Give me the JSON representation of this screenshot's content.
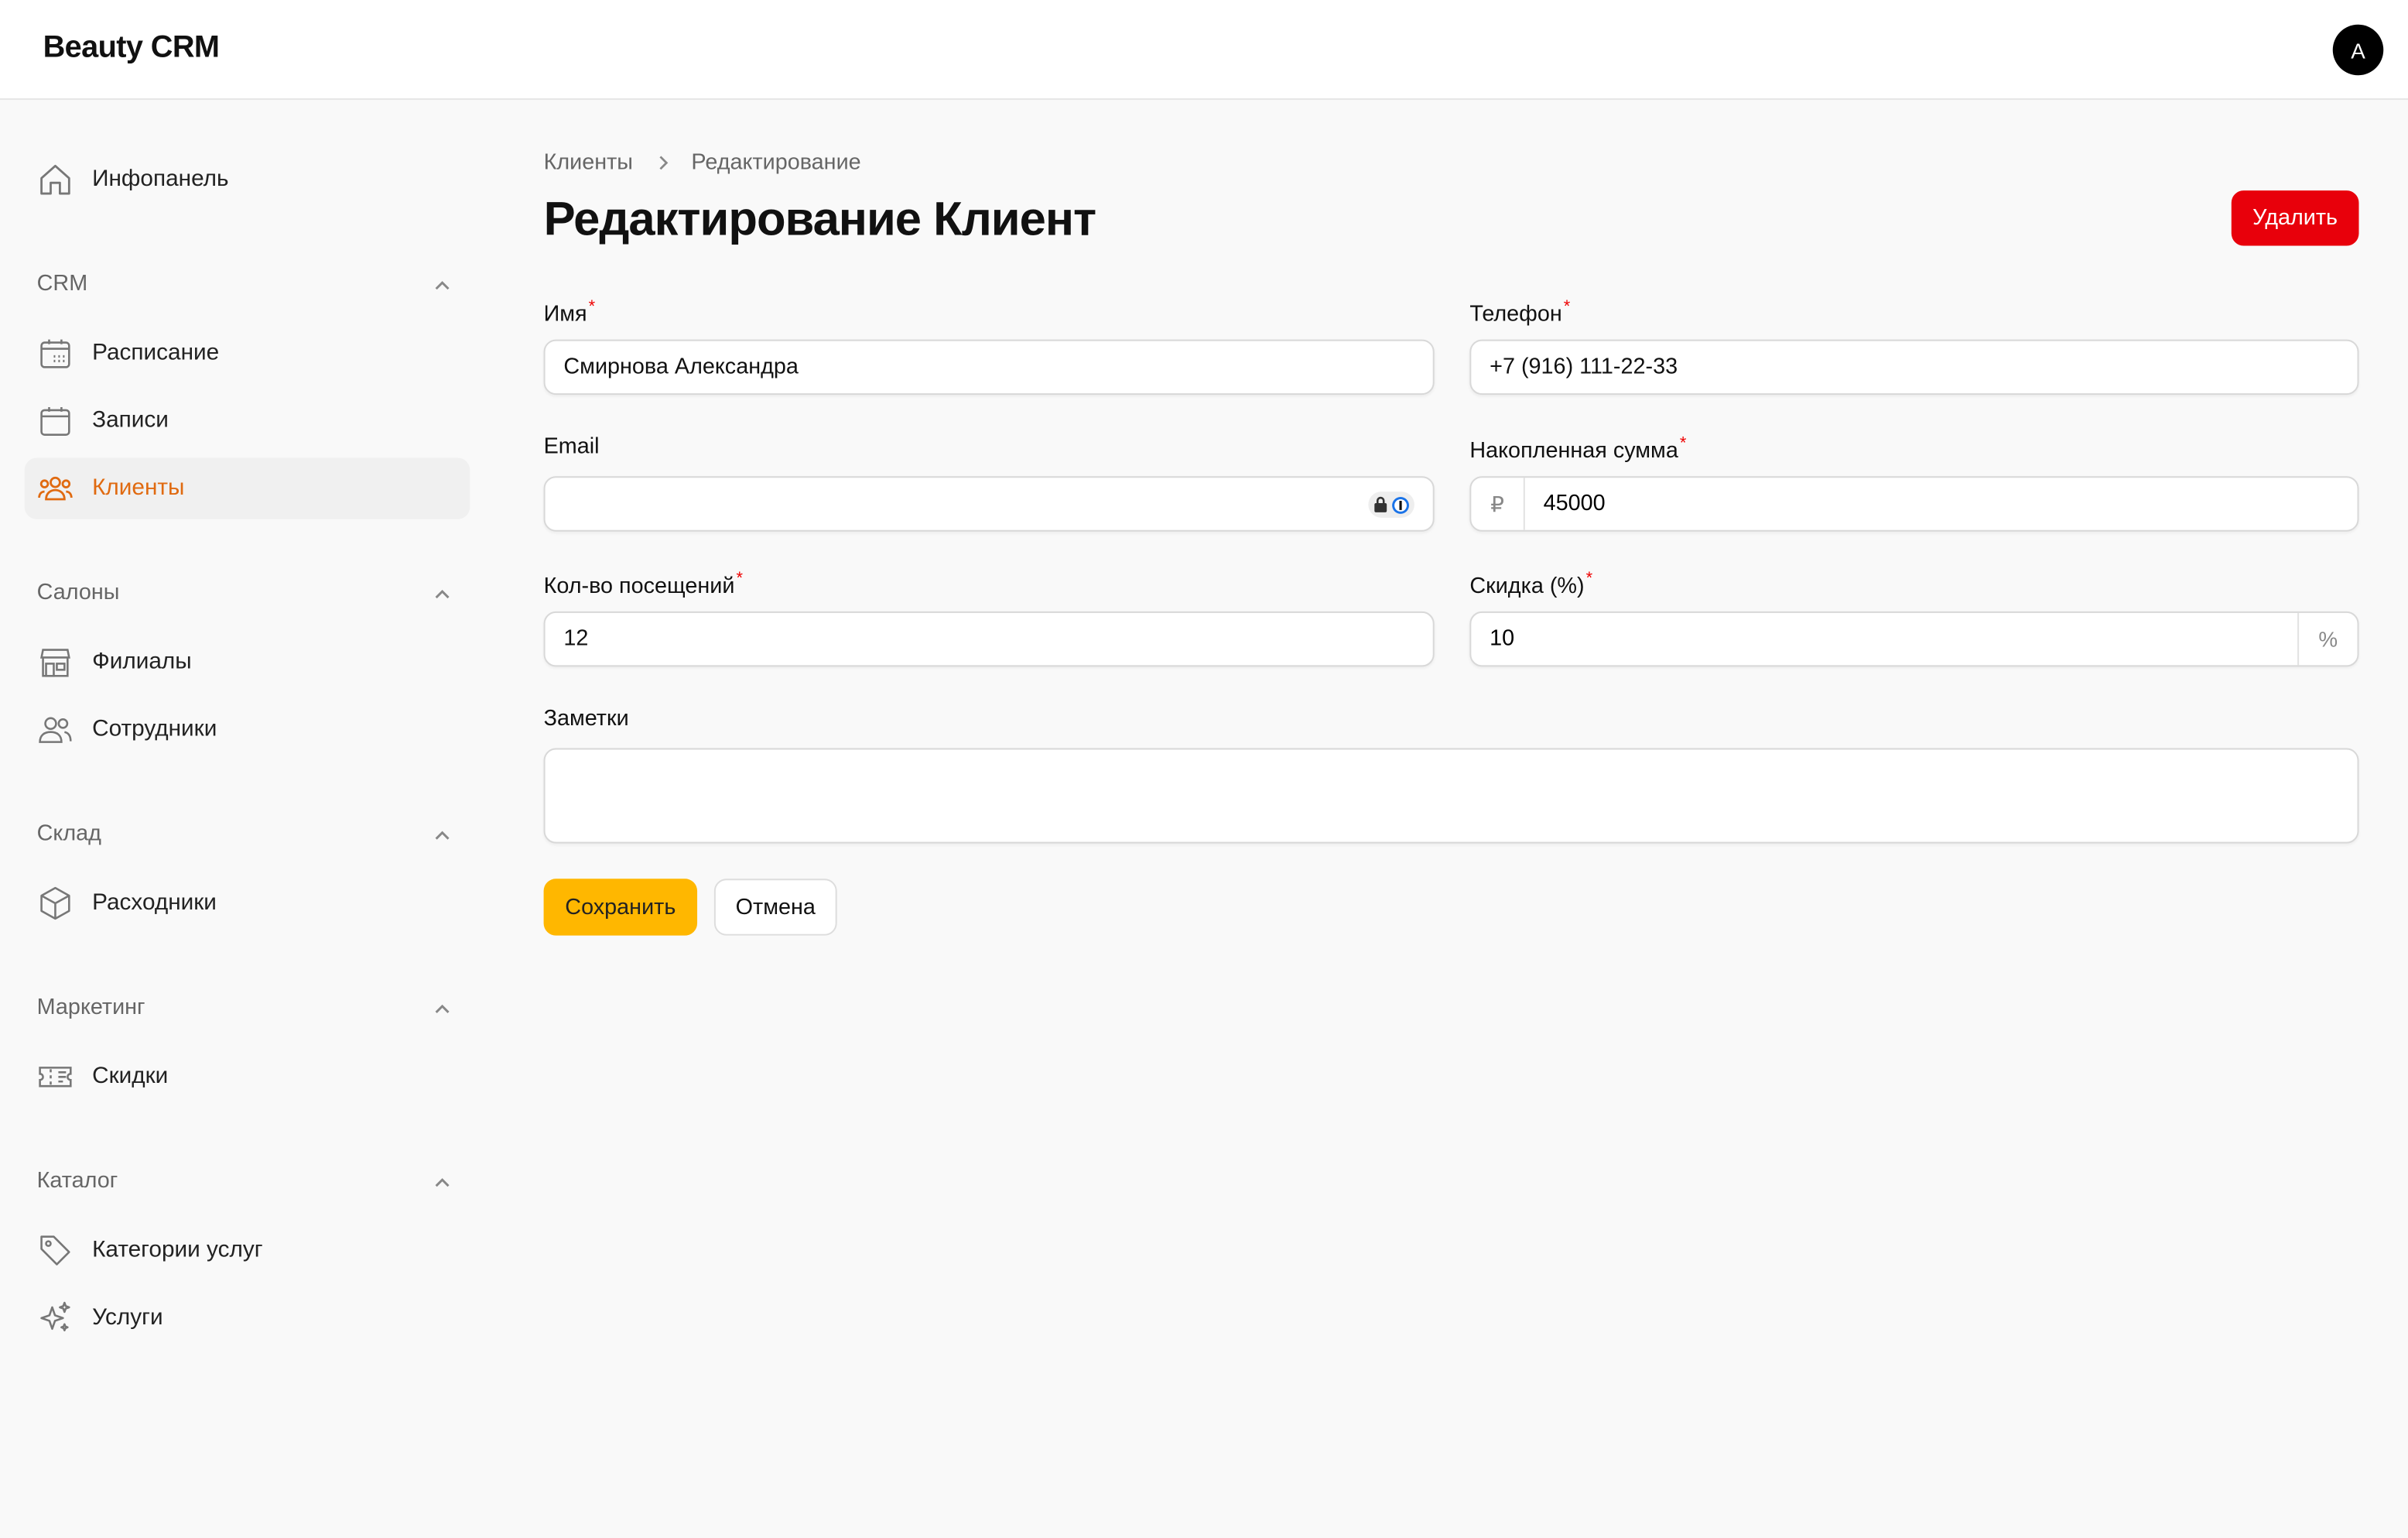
{
  "app": {
    "brand": "Beauty CRM",
    "avatar_initial": "A"
  },
  "sidebar": {
    "dashboard": {
      "label": "Инфопанель",
      "icon": "home-icon"
    },
    "groups": [
      {
        "title": "CRM",
        "items": [
          {
            "label": "Расписание",
            "icon": "schedule-calendar-icon"
          },
          {
            "label": "Записи",
            "icon": "calendar-icon"
          },
          {
            "label": "Клиенты",
            "icon": "users-icon",
            "active": true
          }
        ]
      },
      {
        "title": "Салоны",
        "items": [
          {
            "label": "Филиалы",
            "icon": "storefront-icon"
          },
          {
            "label": "Сотрудники",
            "icon": "staff-icon"
          }
        ]
      },
      {
        "title": "Склад",
        "items": [
          {
            "label": "Расходники",
            "icon": "box-icon"
          }
        ]
      },
      {
        "title": "Маркетинг",
        "items": [
          {
            "label": "Скидки",
            "icon": "ticket-icon"
          }
        ]
      },
      {
        "title": "Каталог",
        "items": [
          {
            "label": "Категории услуг",
            "icon": "tag-icon"
          },
          {
            "label": "Услуги",
            "icon": "sparkles-icon"
          }
        ]
      }
    ]
  },
  "breadcrumb": {
    "parent": "Клиенты",
    "current": "Редактирование"
  },
  "page": {
    "title": "Редактирование Клиент",
    "delete_label": "Удалить"
  },
  "form": {
    "name": {
      "label": "Имя",
      "value": "Смирнова Александра",
      "required": true
    },
    "phone": {
      "label": "Телефон",
      "value": "+7 (916) 111-22-33",
      "required": true
    },
    "email": {
      "label": "Email",
      "value": "",
      "required": false
    },
    "total": {
      "label": "Накопленная сумма",
      "value": "45000",
      "prefix": "₽",
      "required": true
    },
    "visits": {
      "label": "Кол-во посещений",
      "value": "12",
      "required": true
    },
    "discount": {
      "label": "Скидка (%)",
      "value": "10",
      "suffix": "%",
      "required": true
    },
    "notes": {
      "label": "Заметки",
      "value": ""
    },
    "save_label": "Сохранить",
    "cancel_label": "Отмена"
  },
  "colors": {
    "accent": "#e06a10",
    "primary_button": "#ffb700",
    "danger": "#e8000b",
    "required_marker": "#e00000"
  }
}
